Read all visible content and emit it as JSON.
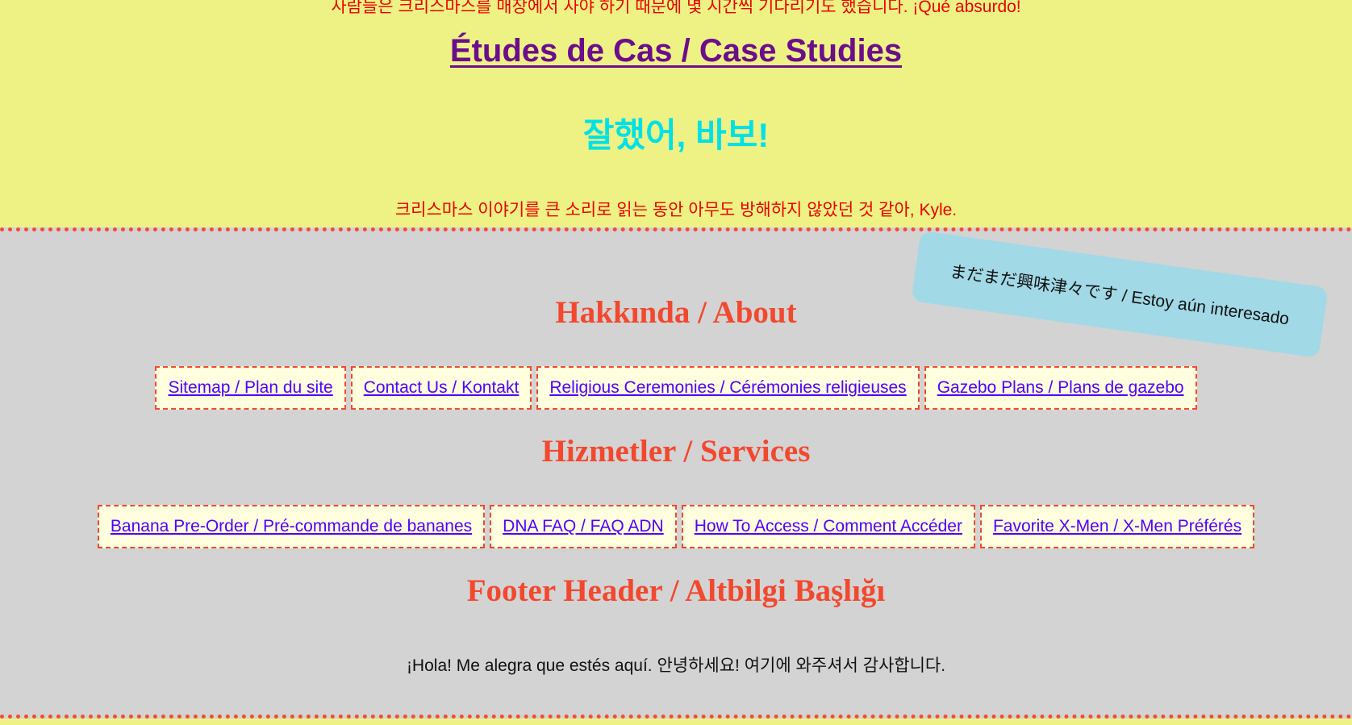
{
  "header": {
    "top_line": "사람들은 크리스마스를 매장에서 사야 하기 때문에 몇 시간씩 기다리기도 했습니다. ¡Qué absurdo!",
    "case_studies_link": "Études de Cas / Case Studies",
    "korean_heading": "잘했어, 바보!",
    "korean_sub": "크리스마스 이야기를 큰 소리로 읽는 동안 아무도 방해하지 않았던 것 같아, Kyle."
  },
  "sticker": {
    "text": "まだまだ興味津々です / Estoy aún interesado"
  },
  "about": {
    "heading": "Hakkında / About",
    "links": [
      "Sitemap / Plan du site",
      "Contact Us / Kontakt",
      "Religious Ceremonies / Cérémonies religieuses",
      "Gazebo Plans / Plans de gazebo"
    ]
  },
  "services": {
    "heading": "Hizmetler / Services",
    "links": [
      "Banana Pre-Order / Pré-commande de bananes",
      "DNA FAQ / FAQ ADN",
      "How To Access / Comment Accéder",
      "Favorite X-Men / X-Men Préférés"
    ]
  },
  "footer": {
    "heading": "Footer Header / Altbilgi Başlığı",
    "text": "¡Hola! Me alegra que estés aquí. 안녕하세요! 여기에 와주셔서 감사합니다."
  },
  "colors": {
    "top_background": "#eef285",
    "band_background": "#d3d3d3",
    "heading_orange": "#f2482e",
    "link_blue": "#5100ff",
    "case_purple": "#6b0d8c",
    "korean_cyan": "#00e1e6",
    "text_red": "#ee0000",
    "sticker_blue": "#a2d9e6",
    "link_box_bg": "#ffffe0"
  }
}
